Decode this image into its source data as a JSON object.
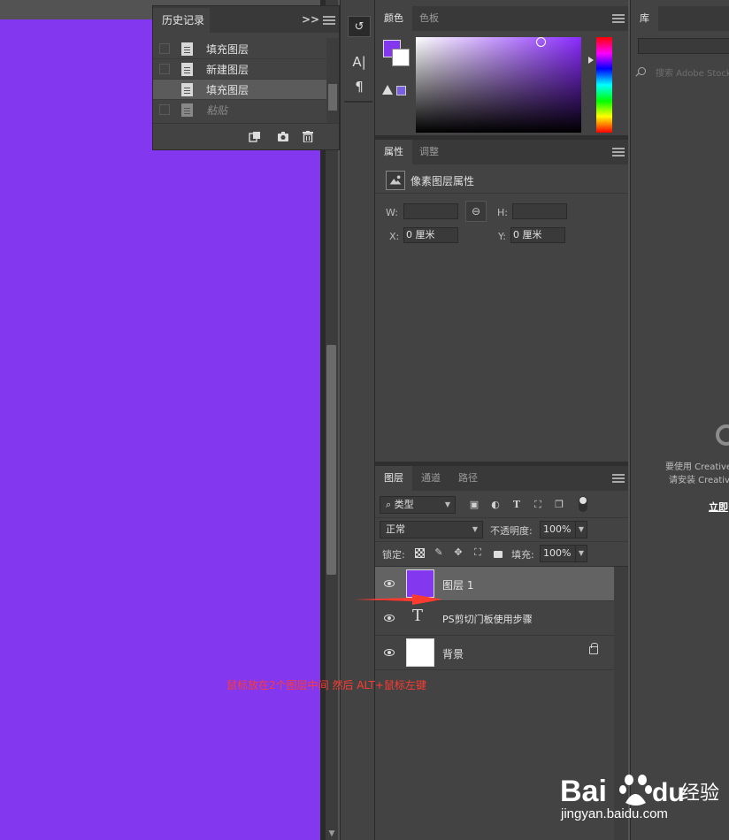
{
  "colors": {
    "canvas_fill": "#8338f0",
    "accent_red": "#ff3b30",
    "panel_bg": "#434343",
    "app_bg": "#535353"
  },
  "history": {
    "tab_label": "历史记录",
    "collapse_label": ">>",
    "items": [
      {
        "label": "填充图层",
        "state": "normal"
      },
      {
        "label": "新建图层",
        "state": "normal"
      },
      {
        "label": "填充图层",
        "state": "selected"
      },
      {
        "label": "粘贴",
        "state": "dimmed"
      }
    ],
    "footer_icons": [
      "new-document-from-state-icon",
      "camera-snapshot-icon",
      "trash-icon"
    ]
  },
  "tools": {
    "icons": [
      "history-brush-icon",
      "character-icon",
      "paragraph-icon"
    ],
    "character_glyph": "A|",
    "paragraph_glyph": "¶",
    "history_glyph": "↺"
  },
  "color_panel": {
    "tabs": [
      "颜色",
      "色板"
    ],
    "active_tab": 0,
    "foreground": "#8338f0",
    "background": "#ffffff"
  },
  "properties": {
    "tabs": [
      "属性",
      "调整"
    ],
    "title": "像素图层属性",
    "w_label": "W:",
    "h_label": "H:",
    "x_label": "X:",
    "y_label": "Y:",
    "w_value": "",
    "h_value": "",
    "x_value": "0 厘米",
    "y_value": "0 厘米",
    "link_glyph": "⊖"
  },
  "layers": {
    "tabs": [
      "图层",
      "通道",
      "路径"
    ],
    "filter_label": "类型",
    "filter_prefix": "⌕",
    "filter_icons": [
      "image-filter-icon",
      "adjustment-filter-icon",
      "type-filter-icon",
      "shape-filter-icon",
      "smart-object-filter-icon",
      "filter-toggle-icon"
    ],
    "blend_mode": "正常",
    "opacity_label": "不透明度:",
    "opacity_value": "100%",
    "lock_label": "锁定:",
    "fill_label": "填充:",
    "fill_value": "100%",
    "lock_icons": [
      "lock-transparent-icon",
      "lock-paint-icon",
      "lock-position-icon",
      "lock-artboard-icon",
      "lock-all-icon"
    ],
    "items": [
      {
        "name": "图层 1",
        "kind": "pixel",
        "thumb": "#8338f0",
        "selected": true
      },
      {
        "name": "PS剪切门板使用步骤",
        "kind": "text",
        "selected": false
      },
      {
        "name": "背景",
        "kind": "background",
        "thumb": "#ffffff",
        "selected": false,
        "locked": true
      }
    ]
  },
  "library": {
    "tab_label": "库",
    "search_hint": "搜索 Adobe Stock",
    "message_line1": "要使用 Creative",
    "message_line2": "请安装 Creative",
    "link_label": "立即"
  },
  "annotation": {
    "text": "鼠标放在2个图层中间 然后 ALT+鼠标左键"
  },
  "watermark": {
    "brand": "Bai",
    "brand_suffix": "du",
    "brand_cn": "经验",
    "url": "jingyan.baidu.com"
  }
}
